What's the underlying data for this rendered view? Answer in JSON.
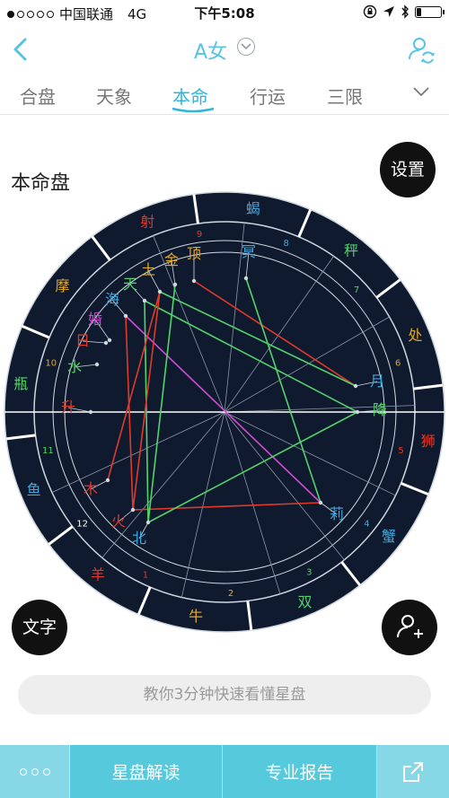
{
  "status_bar": {
    "carrier": "中国联通",
    "network": "4G",
    "time": "下午5:08",
    "battery_level": 0.2,
    "signal_bars_filled": 1
  },
  "nav": {
    "title": "A女",
    "back_icon": "chevron-left-icon",
    "user_switch_icon": "user-switch-icon"
  },
  "tabs": [
    {
      "label": "合盘",
      "active": false
    },
    {
      "label": "天象",
      "active": false
    },
    {
      "label": "本命",
      "active": true
    },
    {
      "label": "行运",
      "active": false
    },
    {
      "label": "三限",
      "active": false
    }
  ],
  "section_title": "本命盘",
  "buttons": {
    "settings": "设置",
    "text": "文字",
    "add_person_icon": "add-person-icon"
  },
  "chart": {
    "signs": [
      {
        "label": "蝎",
        "color": "#3fa9dc"
      },
      {
        "label": "秤",
        "color": "#53d36b"
      },
      {
        "label": "处",
        "color": "#e0a82e"
      },
      {
        "label": "狮",
        "color": "#e23a2a"
      },
      {
        "label": "蟹",
        "color": "#3fa9dc"
      },
      {
        "label": "双",
        "color": "#53d36b"
      },
      {
        "label": "牛",
        "color": "#e0a82e"
      },
      {
        "label": "羊",
        "color": "#e23a2a"
      },
      {
        "label": "鱼",
        "color": "#3fa9dc"
      },
      {
        "label": "瓶",
        "color": "#53d36b"
      },
      {
        "label": "摩",
        "color": "#e0a82e"
      },
      {
        "label": "射",
        "color": "#e23a2a"
      }
    ],
    "houses": [
      "9",
      "8",
      "7",
      "6",
      "5",
      "4",
      "3",
      "2",
      "1",
      "12",
      "11",
      "10"
    ],
    "points": [
      {
        "label": "月",
        "color": "#3fa9dc"
      },
      {
        "label": "降",
        "color": "#53d36b"
      },
      {
        "label": "莉",
        "color": "#3fa9dc"
      },
      {
        "label": "北",
        "color": "#3fa9dc"
      },
      {
        "label": "火",
        "color": "#e23a2a"
      },
      {
        "label": "木",
        "color": "#e23a2a"
      },
      {
        "label": "升",
        "color": "#e23a2a"
      },
      {
        "label": "水",
        "color": "#53d36b"
      },
      {
        "label": "日",
        "color": "#e23a2a"
      },
      {
        "label": "婚",
        "color": "#d24bd6"
      },
      {
        "label": "海",
        "color": "#3fa9dc"
      },
      {
        "label": "天",
        "color": "#53d36b"
      },
      {
        "label": "土",
        "color": "#e0a82e"
      },
      {
        "label": "金",
        "color": "#e0a82e"
      },
      {
        "label": "顶",
        "color": "#e0a82e"
      },
      {
        "label": "冥",
        "color": "#3fa9dc"
      }
    ]
  },
  "tip": "教你3分钟快速看懂星盘",
  "bottom_bar": {
    "more_icon": "more-dots-icon",
    "read": "星盘解读",
    "report": "专业报告",
    "share_icon": "share-icon"
  }
}
